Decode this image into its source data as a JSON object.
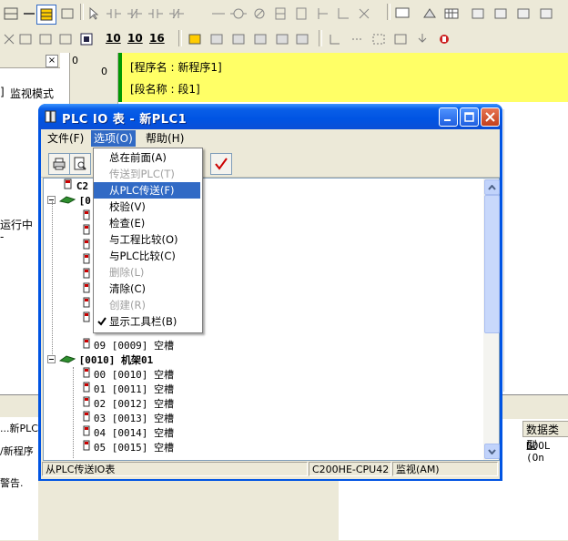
{
  "background": {
    "program_label": "[程序名 : 新程序1]",
    "section_label": "[段名称 : 段1]",
    "rung_number": "0",
    "rung_address": "0",
    "left_text_monitor": "监视模式",
    "left_text_running": "运行中",
    "left_text_bracket": "]",
    "left_text_dash": "-",
    "tab_new_plc": "...新PLC",
    "tab_program": "/新程序",
    "tab_warn": "警告.",
    "grid_header": "数据类型",
    "grid_cell": "BOOL (On",
    "toolbar_numbers": [
      "10",
      "10",
      "16"
    ]
  },
  "dialog": {
    "title": "PLC IO 表 - 新PLC1",
    "menus": [
      {
        "label": "文件(F)"
      },
      {
        "label": "选项(O)"
      },
      {
        "label": "帮助(H)"
      }
    ],
    "dropdown": [
      {
        "label": "总在前面(A)",
        "disabled": false,
        "check": false
      },
      {
        "label": "传送到PLC(T)",
        "disabled": true,
        "check": false
      },
      {
        "label": "从PLC传送(F)",
        "disabled": false,
        "check": false,
        "highlighted": true
      },
      {
        "label": "校验(V)",
        "disabled": false,
        "check": false
      },
      {
        "label": "检查(E)",
        "disabled": false,
        "check": false
      },
      {
        "label": "与工程比较(O)",
        "disabled": false,
        "check": false
      },
      {
        "label": "与PLC比较(C)",
        "disabled": false,
        "check": false
      },
      {
        "label": "删除(L)",
        "disabled": true,
        "check": false
      },
      {
        "label": "清除(C)",
        "disabled": false,
        "check": false
      },
      {
        "label": "创建(R)",
        "disabled": true,
        "check": false
      },
      {
        "label": "显示工具栏(B)",
        "disabled": false,
        "check": true
      }
    ],
    "tree": {
      "root_label": "C2",
      "rack0_label": "[0",
      "slot09": "09  [0009]  空槽",
      "rack1_label": "[0010]  机架01",
      "rack1_slots": [
        "00  [0010]  空槽",
        "01  [0011]  空槽",
        "02  [0012]  空槽",
        "03  [0013]  空槽",
        "04  [0014]  空槽",
        "05  [0015]  空槽"
      ]
    },
    "status": {
      "message": "从PLC传送IO表",
      "cpu": "C200HE-CPU42",
      "mode": "监视(AM)"
    }
  },
  "colors": {
    "title_bar": "#0054e3",
    "highlight": "#316ac5",
    "yellow_band": "#ffff66",
    "green_bar": "#009900"
  }
}
